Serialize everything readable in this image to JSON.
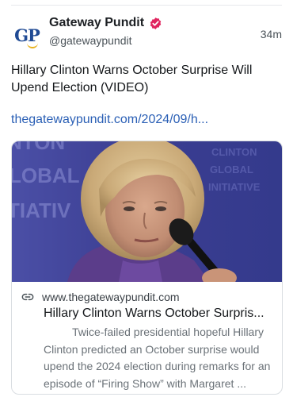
{
  "post": {
    "author": {
      "display_name": "Gateway Pundit",
      "handle": "@gatewaypundit",
      "avatar_text": "GP",
      "verified": true,
      "verified_color": "#e0245e"
    },
    "timestamp": "34m",
    "text": "Hillary Clinton Warns October Surprise Will Upend Election (VIDEO)",
    "link_text": "thegatewaypundit.com/2024/09/h...",
    "link_color": "#2a5fb5"
  },
  "card": {
    "domain": "www.thegatewaypundit.com",
    "title": "Hillary Clinton Warns October Surpris...",
    "description": "Twice-failed presidential hopeful Hillary Clinton predicted an October surprise would upend the 2024 election during remarks for an episode of “Firing Show” with Margaret ...",
    "image_text_left": [
      "NTON",
      "LOBAL",
      "TIATIV"
    ],
    "image_text_right": [
      "CLINTON",
      "GLOBAL",
      "INITIATIVE"
    ],
    "link_icon": "link-icon"
  },
  "icons": {
    "verified": "verified-badge-icon",
    "link": "link-icon"
  }
}
